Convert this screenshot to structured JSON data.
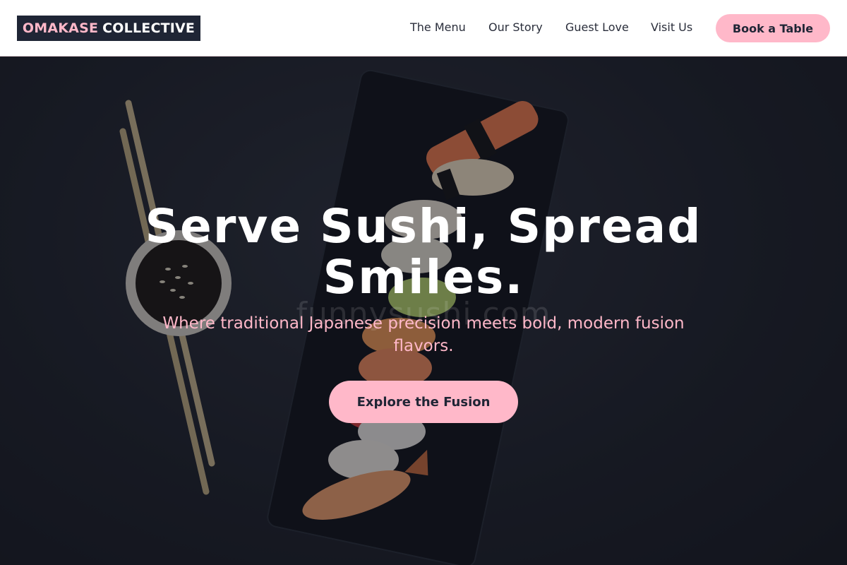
{
  "brand": {
    "name_part1": "OMAKASE",
    "name_part2": "COLLECTIVE"
  },
  "nav": {
    "items": [
      {
        "label": "The Menu"
      },
      {
        "label": "Our Story"
      },
      {
        "label": "Guest Love"
      },
      {
        "label": "Visit Us"
      }
    ],
    "cta_label": "Book a Table"
  },
  "hero": {
    "headline": "Serve Sushi, Spread Smiles.",
    "subheadline": "Where traditional Japanese precision meets bold, modern fusion flavors.",
    "cta_label": "Explore the Fusion",
    "watermark": "funnysushi.com"
  },
  "colors": {
    "accent": "#ffb8c9",
    "dark": "#1f2535",
    "white": "#ffffff"
  }
}
